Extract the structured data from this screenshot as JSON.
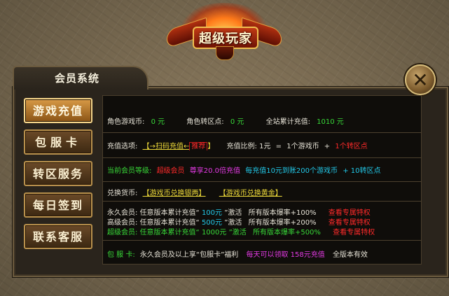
{
  "emblem": {
    "title": "超级玩家"
  },
  "window": {
    "title": "会员系统",
    "close_symbol": "✕"
  },
  "sidebar": {
    "items": [
      {
        "label": "游戏充值",
        "active": true
      },
      {
        "label": "包服卡",
        "active": false
      },
      {
        "label": "转区服务",
        "active": false
      },
      {
        "label": "每日签到",
        "active": false
      },
      {
        "label": "联系客服",
        "active": false
      }
    ]
  },
  "balance": {
    "game_coin_label": "角色游戏币:",
    "game_coin_value": "0 元",
    "transfer_points_label": "角色转区点:",
    "transfer_points_value": "0 元",
    "total_recharge_label": "全站累计充值:",
    "total_recharge_value": "1010 元"
  },
  "recharge": {
    "options_label": "充值选项:",
    "scan_link": "【→扫码充值←",
    "recommend": "推荐",
    "bracket_close": "】",
    "ratio_label": "充值比例:",
    "ratio_a": "1元",
    "ratio_eq": "=",
    "ratio_b": "1个游戏币",
    "ratio_plus": "+",
    "ratio_c": "1个转区点"
  },
  "level": {
    "label": "当前会员等级:",
    "value": "超级会员",
    "perk_a": "尊享20.0倍充值",
    "perk_b": "每充值10元到账200个游戏币",
    "perk_c": "+ 10转区点"
  },
  "exchange": {
    "label": "兑换货币:",
    "silver_link": "【游戏币兑换银两】",
    "gold_link": "【游戏币兑换黄金】"
  },
  "membership": [
    {
      "name": "永久会员:",
      "text_a": "任意版本累计充值“",
      "amount": "100元",
      "text_b": "”激活",
      "rate": "所有版本爆率+100%",
      "link": "查看专属特权",
      "color": "c"
    },
    {
      "name": "高级会员:",
      "text_a": "任意版本累计充值“",
      "amount": "500元",
      "text_b": "”激活",
      "rate": "所有版本爆率+200%",
      "link": "查看专属特权",
      "color": "c"
    },
    {
      "name": "超级会员:",
      "text_a": "任意版本累计充值“",
      "amount": "1000元",
      "text_b": "”激活",
      "rate": "所有版本爆率+500%",
      "link": "查看专属特权",
      "color": "g"
    }
  ],
  "server_card": {
    "label": "包 服 卡:",
    "text_a": "永久会员及以上享“包服卡”福利",
    "daily": "每天可以领取 158元充值",
    "text_b": "全版本有效"
  },
  "colors": {
    "green": "#38d838",
    "red": "#ff2a2a",
    "cyan": "#22c8e8",
    "yellow": "#f0dc3a",
    "magenta": "#e43ae4",
    "frame": "#6b5a3e"
  }
}
